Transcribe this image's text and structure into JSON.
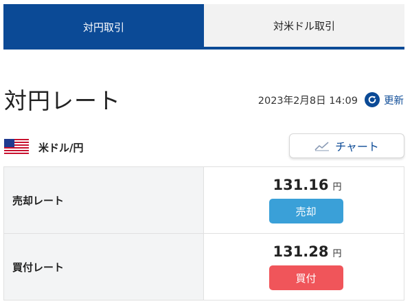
{
  "tabs": [
    {
      "label": "対円取引",
      "active": true
    },
    {
      "label": "対米ドル取引",
      "active": false
    }
  ],
  "page_title": "対円レート",
  "timestamp": "2023年2月8日 14:09",
  "refresh_label": "更新",
  "currency_pair": {
    "flag": "us-flag-icon",
    "label": "米ドル/円"
  },
  "chart_button_label": "チャート",
  "rates": {
    "sell": {
      "label": "売却レート",
      "value": "131.16",
      "unit": "円",
      "button_label": "売却",
      "button_color": "#3aa0d8"
    },
    "buy": {
      "label": "買付レート",
      "value": "131.28",
      "unit": "円",
      "button_label": "買付",
      "button_color": "#f0555a"
    }
  },
  "colors": {
    "brand": "#0b4a96"
  }
}
